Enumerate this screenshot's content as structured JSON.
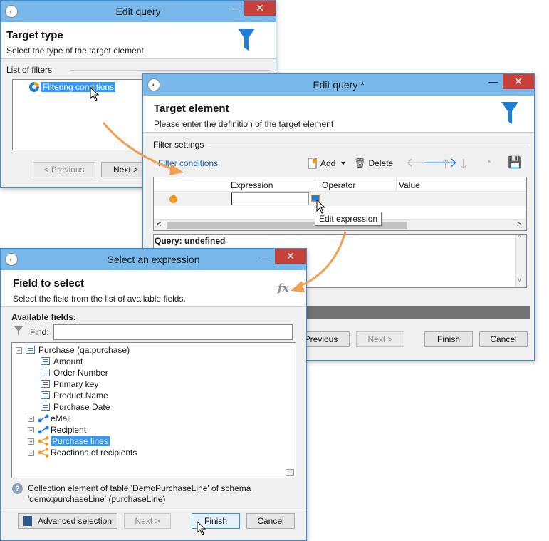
{
  "win1": {
    "title": "Edit query",
    "header_title": "Target type",
    "header_subtitle": "Select the type of the target element",
    "list_label": "List of filters",
    "list_item": "Filtering conditions",
    "prev_button": "< Previous",
    "next_button": "Next >"
  },
  "win2": {
    "title": "Edit query *",
    "header_title": "Target element",
    "header_subtitle": "Please enter the definition of the target element",
    "section_label": "Filter settings",
    "filter_conditions_link": "Filter conditions",
    "toolbar": {
      "add_label": "Add",
      "delete_label": "Delete"
    },
    "grid_headers": [
      "Expression",
      "Operator",
      "Value"
    ],
    "tooltip": "Edit expression",
    "query_label": "Query: undefined",
    "prev_button": "Previous",
    "next_button": "Next >",
    "finish_button": "Finish",
    "cancel_button": "Cancel"
  },
  "win3": {
    "title": "Select an expression",
    "header_title": "Field to select",
    "header_subtitle": "Select the field from the list of available fields.",
    "fx_label": "fx",
    "available_label": "Available fields:",
    "find_label": "Find:",
    "find_value": "",
    "tree": {
      "root": "Purchase (qa:purchase)",
      "fields": [
        "Amount",
        "Order Number",
        "Primary key",
        "Product Name",
        "Purchase Date"
      ],
      "links": [
        "eMail",
        "Recipient",
        "Purchase lines",
        "Reactions of recipients"
      ]
    },
    "info_line1": "Collection element of table 'DemoPurchaseLine' of schema",
    "info_line2": "'demo:purchaseLine' (purchaseLine)",
    "advanced_button": "Advanced selection",
    "next_button": "Next >",
    "finish_button": "Finish",
    "cancel_button": "Cancel"
  },
  "colors": {
    "titlebar": "#79b8ea",
    "close": "#c7413b",
    "accent": "#1e7fd8",
    "arrow": "#f0a050",
    "bullet": "#f29b1d"
  }
}
